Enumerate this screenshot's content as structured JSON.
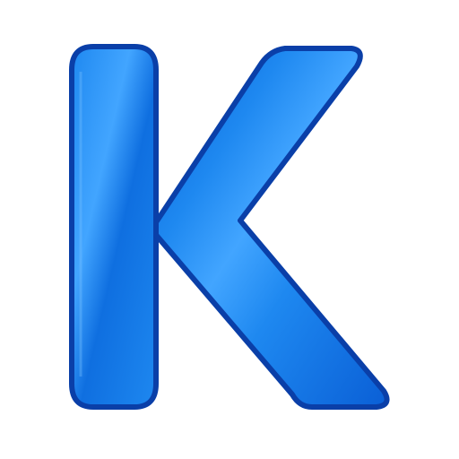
{
  "icon": {
    "name": "letter-k-icon",
    "letter": "K",
    "colors": {
      "fill_light": "#42a5ff",
      "fill_mid": "#1e88f0",
      "fill_dark": "#0a5fd6",
      "outline": "#0a3fa8",
      "background": "#ffffff"
    }
  }
}
